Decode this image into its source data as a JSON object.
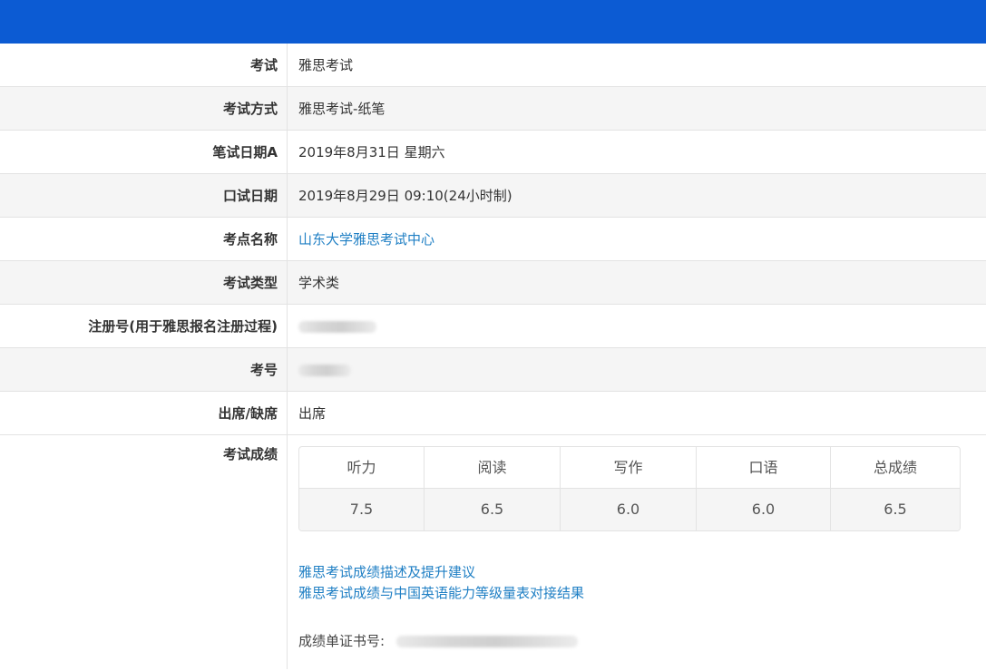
{
  "colors": {
    "header": "#0c5bd3",
    "link": "#1f7fc4",
    "row_alt": "#f5f5f5",
    "border": "#e3e3e3"
  },
  "rows": [
    {
      "label": "考试",
      "value": "雅思考试"
    },
    {
      "label": "考试方式",
      "value": "雅思考试-纸笔"
    },
    {
      "label": "笔试日期A",
      "value": "2019年8月31日 星期六"
    },
    {
      "label": "口试日期",
      "value": "2019年8月29日 09:10(24小时制)"
    },
    {
      "label": "考点名称",
      "value": "山东大学雅思考试中心"
    },
    {
      "label": "考试类型",
      "value": "学术类"
    },
    {
      "label": "注册号(用于雅思报名注册过程)",
      "value": ""
    },
    {
      "label": "考号",
      "value": ""
    },
    {
      "label": "出席/缺席",
      "value": "出席"
    }
  ],
  "scores": {
    "label": "考试成绩",
    "headers": [
      "听力",
      "阅读",
      "写作",
      "口语",
      "总成绩"
    ],
    "values": [
      "7.5",
      "6.5",
      "6.0",
      "6.0",
      "6.5"
    ]
  },
  "links": [
    "雅思考试成绩描述及提升建议",
    "雅思考试成绩与中国英语能力等级量表对接结果"
  ],
  "certificate": {
    "label": "成绩单证书号:"
  }
}
